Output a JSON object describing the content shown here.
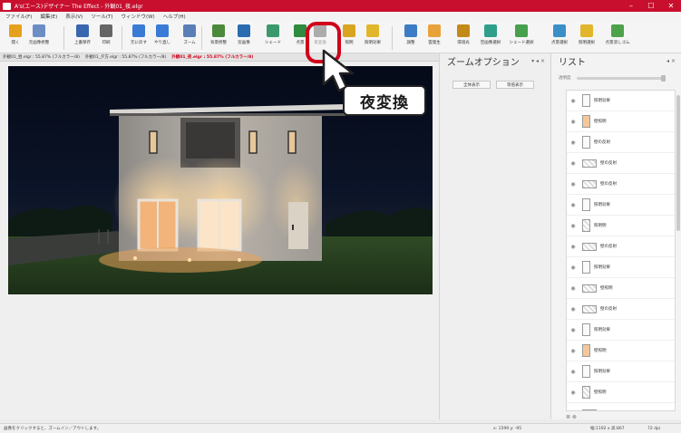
{
  "window": {
    "title": "A's(エース)デザイナー The Effect - 外観01_夜.elgr",
    "minimize_glyph": "–",
    "maximize_glyph": "☐",
    "close_glyph": "✕"
  },
  "menu": [
    "ファイル(F)",
    "編集(E)",
    "表示(V)",
    "ツール(T)",
    "ウィンドウ(W)",
    "ヘルプ(H)"
  ],
  "toolbar": {
    "items": [
      {
        "label": "開く",
        "icon": "open-folder-icon",
        "color": "#e6a01e"
      },
      {
        "label": "元画像修整",
        "icon": "restore-image-icon",
        "color": "#6b8fc4"
      },
      {
        "label": "上書保存",
        "icon": "save-icon",
        "color": "#3a66b0"
      },
      {
        "label": "印刷",
        "icon": "print-icon",
        "color": "#666666"
      },
      {
        "label": "元に戻す",
        "icon": "undo-icon",
        "color": "#3a7bd5"
      },
      {
        "label": "やり直し",
        "icon": "redo-icon",
        "color": "#3a7bd5"
      },
      {
        "label": "ズーム",
        "icon": "zoom-icon",
        "color": "#5a7fb8"
      },
      {
        "label": "背景修整",
        "icon": "background-icon",
        "color": "#4b8a3a"
      },
      {
        "label": "窓画像",
        "icon": "window-image-icon",
        "color": "#2b6cb0"
      },
      {
        "label": "シェード",
        "icon": "shade-icon",
        "color": "#3a9a6b"
      },
      {
        "label": "点景",
        "icon": "scenery-icon",
        "color": "#2f8b3f"
      },
      {
        "label": "夜変換",
        "icon": "night-convert-icon",
        "color": "#555555"
      },
      {
        "label": "照明",
        "icon": "lighting-icon",
        "color": "#d9a520"
      },
      {
        "label": "照明効果",
        "icon": "light-effect-icon",
        "color": "#e2b62b"
      },
      {
        "label": "調整",
        "icon": "adjust-icon",
        "color": "#3b7cc4"
      },
      {
        "label": "雲発生",
        "icon": "cloud-icon",
        "color": "#e8a23a"
      },
      {
        "label": "環境光",
        "icon": "ambient-light-icon",
        "color": "#c48a18"
      },
      {
        "label": "空画像選択",
        "icon": "sky-select-icon",
        "color": "#2e9f8b"
      },
      {
        "label": "シェード選択",
        "icon": "shade-select-icon",
        "color": "#47a04b"
      },
      {
        "label": "点景選択",
        "icon": "scenery-select-icon",
        "color": "#3b8fc8"
      },
      {
        "label": "照明選択",
        "icon": "light-select-icon",
        "color": "#e2b62b"
      },
      {
        "label": "点景消しゴム",
        "icon": "eraser-icon",
        "color": "#4ea24b"
      }
    ]
  },
  "doc_tabs": [
    {
      "label": "外観01_昼.elgr : 55.87% (フルカラー/8)",
      "active": false
    },
    {
      "label": "外観01_夕方.elgr : 55.87% (フルカラー/8)",
      "active": false
    },
    {
      "label": "外観01_夜.elgr : 55.87% (フルカラー/8)",
      "active": true
    }
  ],
  "zoom_panel": {
    "title": "ズームオプション",
    "controls": "▾ ◂ ×",
    "fit_button": "全体表示",
    "actual_button": "等倍表示"
  },
  "list_panel": {
    "title": "リスト",
    "controls": "◂ ×",
    "opacity_label": "透明度",
    "items": [
      {
        "label": "照明効果",
        "thumb": "tall"
      },
      {
        "label": "壁照明",
        "thumb": "warm"
      },
      {
        "label": "壁の反射",
        "thumb": "tall"
      },
      {
        "label": "壁の反射",
        "thumb": "wide"
      },
      {
        "label": "壁の反射",
        "thumb": "wide"
      },
      {
        "label": "照明効果",
        "thumb": "tall"
      },
      {
        "label": "照明明",
        "thumb": "checker"
      },
      {
        "label": "壁の反射",
        "thumb": "wide"
      },
      {
        "label": "照明効果",
        "thumb": "tall"
      },
      {
        "label": "壁照明",
        "thumb": "wide"
      },
      {
        "label": "壁の反射",
        "thumb": "wide"
      },
      {
        "label": "照明効果",
        "thumb": "tall"
      },
      {
        "label": "壁照明",
        "thumb": "warm"
      },
      {
        "label": "照明効果",
        "thumb": "tall"
      },
      {
        "label": "壁照明",
        "thumb": "checker"
      },
      {
        "label": "壁の反射",
        "thumb": "wide"
      }
    ],
    "footer_icons": "≣ ⊗"
  },
  "statusbar": {
    "hint": "画像をクリックすると、ズームイン／アウトします。",
    "coords": "x: 1599 y: -95",
    "size": "幅:1192 x 高:867",
    "dpi": "72 dpi"
  },
  "callout": {
    "text": "夜変換"
  },
  "colors": {
    "titlebar": "#c8102e",
    "highlight": "#d0021b",
    "active_tab": "#d0021b"
  }
}
